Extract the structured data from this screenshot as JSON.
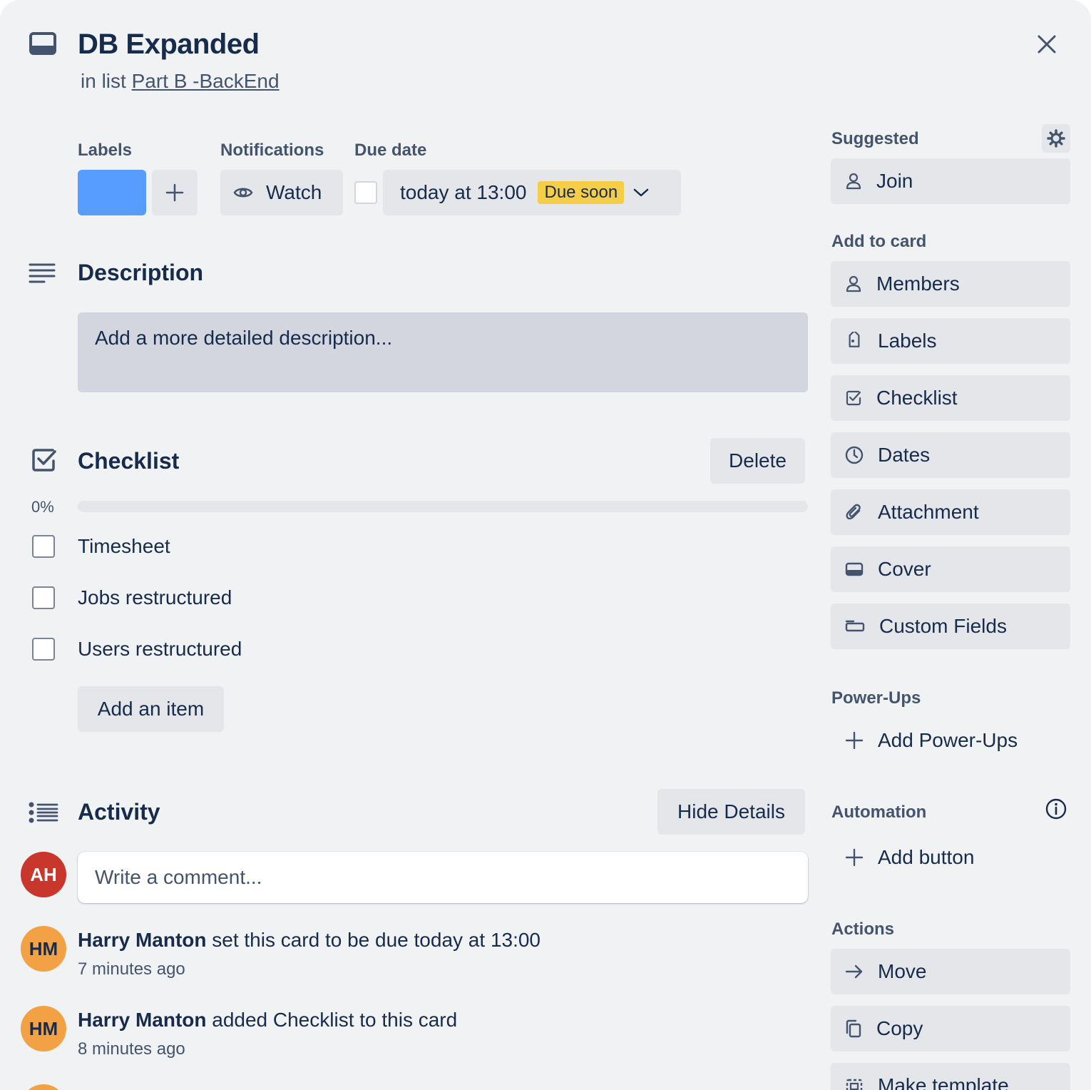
{
  "card": {
    "title": "DB Expanded",
    "list_prefix": "in list",
    "list_name": "Part B -BackEnd"
  },
  "meta": {
    "labels_heading": "Labels",
    "label_color": "#579dff",
    "notifications_heading": "Notifications",
    "watch_label": "Watch",
    "due_heading": "Due date",
    "due_value": "today at 13:00",
    "due_badge": "Due soon"
  },
  "description": {
    "heading": "Description",
    "placeholder": "Add a more detailed description..."
  },
  "checklist": {
    "heading": "Checklist",
    "delete_label": "Delete",
    "percent_label": "0%",
    "progress_fraction": 0,
    "items": [
      {
        "text": "Timesheet",
        "checked": false
      },
      {
        "text": "Jobs restructured",
        "checked": false
      },
      {
        "text": "Users restructured",
        "checked": false
      }
    ],
    "add_item_label": "Add an item"
  },
  "activity": {
    "heading": "Activity",
    "hide_details_label": "Hide Details",
    "current_user_initials": "AH",
    "comment_placeholder": "Write a comment...",
    "entries": [
      {
        "initials": "HM",
        "author": "Harry Manton",
        "action": "set this card to be due today at 13:00",
        "time": "7 minutes ago"
      },
      {
        "initials": "HM",
        "author": "Harry Manton",
        "action": "added Checklist to this card",
        "time": "8 minutes ago"
      }
    ]
  },
  "sidebar": {
    "suggested_heading": "Suggested",
    "join_label": "Join",
    "add_to_card_heading": "Add to card",
    "add_to_card": [
      {
        "label": "Members",
        "icon": "person-icon"
      },
      {
        "label": "Labels",
        "icon": "tag-icon"
      },
      {
        "label": "Checklist",
        "icon": "checkbox-icon"
      },
      {
        "label": "Dates",
        "icon": "clock-icon"
      },
      {
        "label": "Attachment",
        "icon": "paperclip-icon"
      },
      {
        "label": "Cover",
        "icon": "cover-icon"
      },
      {
        "label": "Custom Fields",
        "icon": "custom-fields-icon"
      }
    ],
    "powerups_heading": "Power-Ups",
    "add_powerups_label": "Add Power-Ups",
    "automation_heading": "Automation",
    "add_button_label": "Add button",
    "actions_heading": "Actions",
    "actions": [
      {
        "label": "Move",
        "icon": "arrow-right-icon"
      },
      {
        "label": "Copy",
        "icon": "copy-icon"
      },
      {
        "label": "Make template",
        "icon": "template-icon"
      }
    ]
  }
}
